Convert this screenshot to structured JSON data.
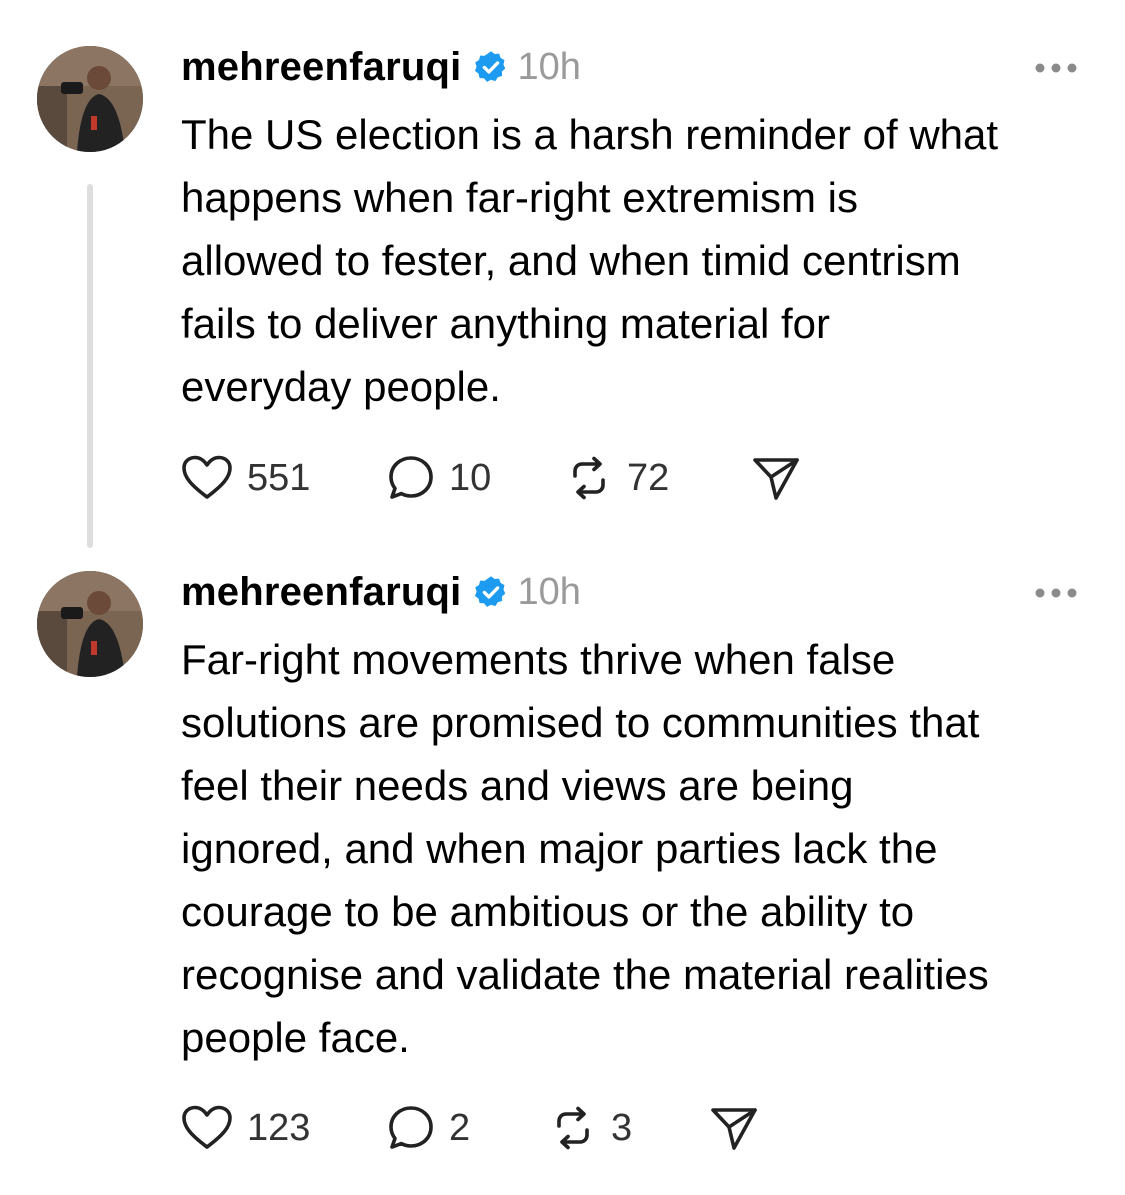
{
  "posts": [
    {
      "username": "mehreenfaruqi",
      "time": "10h",
      "text": "The US election is a harsh reminder of what\nhappens when far-right extremism is\nallowed to fester, and when timid centrism\nfails to deliver anything material for\neveryday people.",
      "likes": "551",
      "replies": "10",
      "reposts": "72"
    },
    {
      "username": "mehreenfaruqi",
      "time": "10h",
      "text": "Far-right movements thrive when false\nsolutions are promised to communities that\nfeel their needs and views are being\nignored, and when major parties lack the\ncourage to be ambitious or the ability to\nrecognise and validate the material realities\npeople face.",
      "likes": "123",
      "replies": "2",
      "reposts": "3"
    }
  ],
  "icons": {
    "verified": "verified-badge-icon",
    "more": "more-options-icon",
    "like": "heart-icon",
    "reply": "comment-bubble-icon",
    "repost": "repost-icon",
    "share": "send-icon"
  },
  "colors": {
    "verified_blue": "#1d9bf0",
    "timestamp_gray": "#9a9a9a",
    "thread_line": "#dedede",
    "action_gray": "#333333"
  }
}
